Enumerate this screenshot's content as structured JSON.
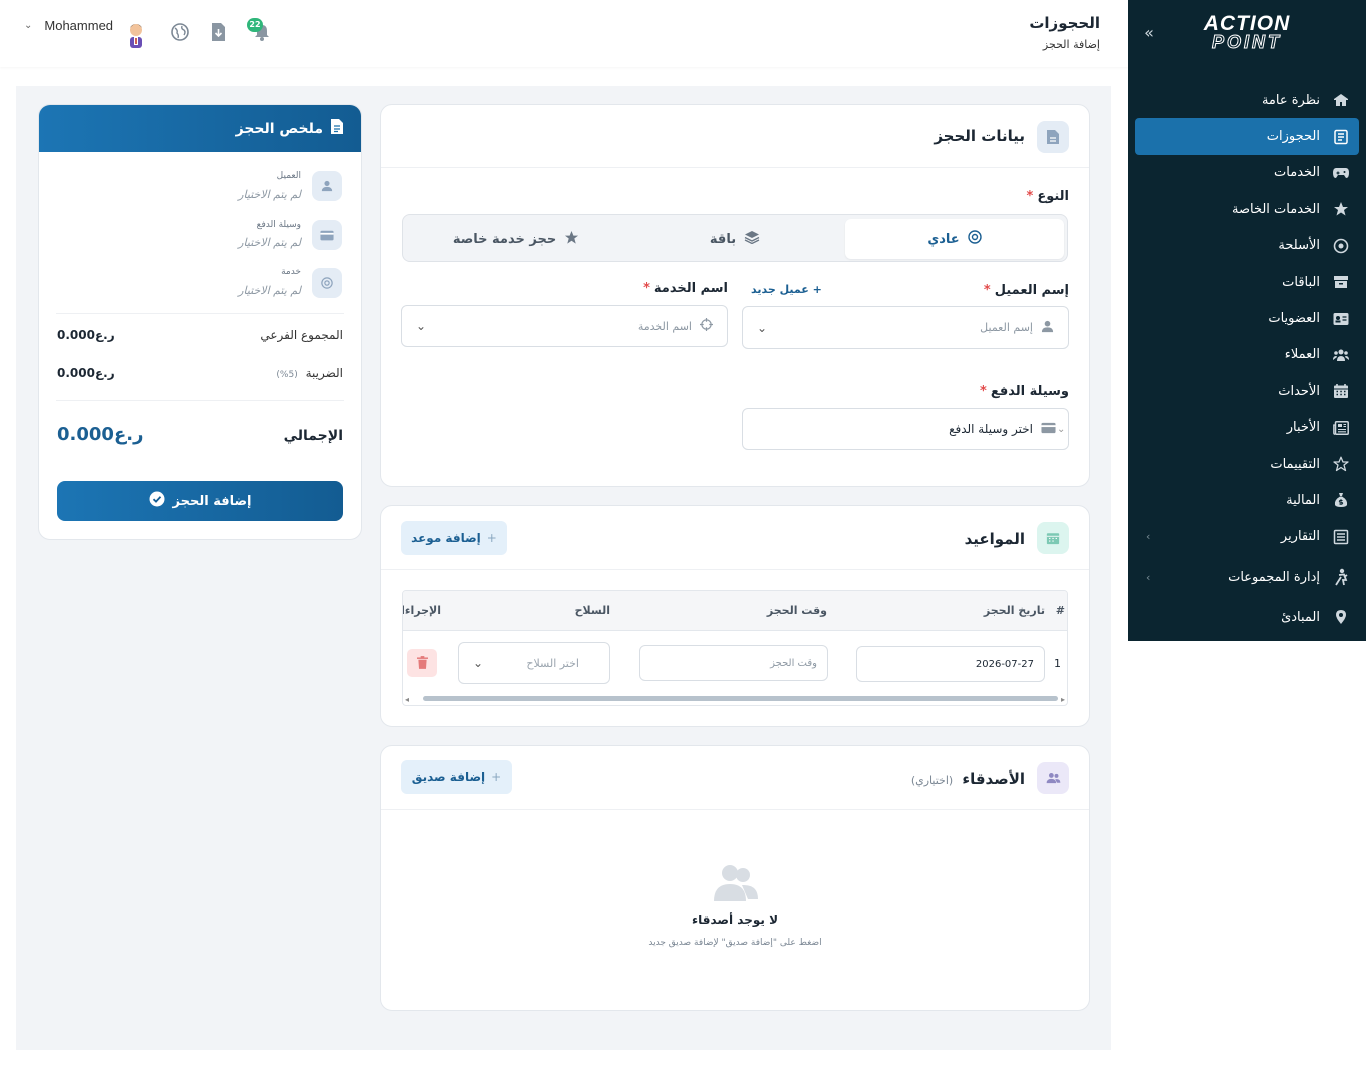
{
  "header": {
    "title": "الحجوزات",
    "subtitle": "إضافة الحجز",
    "user_name": "Mohammed",
    "notification_count": "22"
  },
  "sidebar": {
    "logo_line1": "ACTION",
    "logo_line2": "POINT",
    "items": [
      {
        "label": "نظرة عامة",
        "icon": "home-icon"
      },
      {
        "label": "الحجوزات",
        "icon": "bookings-icon",
        "active": true
      },
      {
        "label": "الخدمات",
        "icon": "gamepad-icon"
      },
      {
        "label": "الخدمات الخاصة",
        "icon": "star-icon"
      },
      {
        "label": "الأسلحة",
        "icon": "weapon-icon"
      },
      {
        "label": "الباقات",
        "icon": "package-icon"
      },
      {
        "label": "العضويات",
        "icon": "id-card-icon"
      },
      {
        "label": "العملاء",
        "icon": "users-icon"
      },
      {
        "label": "الأحداث",
        "icon": "calendar-icon"
      },
      {
        "label": "الأخبار",
        "icon": "news-icon"
      },
      {
        "label": "التقييمات",
        "icon": "star-outline-icon"
      },
      {
        "label": "المالية",
        "icon": "money-bag-icon"
      },
      {
        "label": "التقارير",
        "icon": "report-icon",
        "has_children": true
      },
      {
        "label": "إدارة المجموعات",
        "icon": "group-icon",
        "has_children": true
      },
      {
        "label": "المبادئ",
        "icon": "location-icon"
      }
    ]
  },
  "booking": {
    "title": "بيانات الحجز",
    "type_label": "النوع",
    "type_options": [
      "عادي",
      "باقة",
      "حجز خدمة خاصة"
    ],
    "customer_label": "إسم العميل",
    "new_customer": "عميل جديد",
    "customer_placeholder": "إسم العميل",
    "service_label": "اسم الخدمة",
    "service_placeholder": "اسم الخدمة",
    "payment_label": "وسيلة الدفع",
    "payment_value": "اختر وسيلة الدفع"
  },
  "appointments": {
    "title": "المواعيد",
    "add_button": "إضافة موعد",
    "columns": [
      "#",
      "تاريخ الحجز",
      "وقت الحجز",
      "السلاح",
      "الإجراءا"
    ],
    "rows": [
      {
        "index": "1",
        "date": "2026-07-27",
        "time_placeholder": "وقت الحجز",
        "weapon_placeholder": "اختر السلاح"
      }
    ]
  },
  "friends": {
    "title": "الأصدقاء",
    "optional": "(اختياري)",
    "add_button": "إضافة صديق",
    "empty_title": "لا يوجد أصدقاء",
    "empty_hint": "اضغط على \"إضافة صديق\" لإضافة صديق جديد"
  },
  "summary": {
    "title": "ملخص الحجز",
    "items": [
      {
        "label": "العميل",
        "value": "لم يتم الاختيار"
      },
      {
        "label": "وسيلة الدفع",
        "value": "لم يتم الاختيار"
      },
      {
        "label": "خدمة",
        "value": "لم يتم الاختيار"
      }
    ],
    "subtotal_label": "المجموع الفرعي",
    "subtotal_value": "0.000",
    "tax_label": "الضريبة",
    "tax_rate": "(5%)",
    "tax_value": "0.000",
    "currency": "ر.ع",
    "total_label": "الإجمالي",
    "total_value": "0.000",
    "submit_button": "إضافة الحجز"
  },
  "colors": {
    "sidebar": "#0b2530",
    "primary": "#1b71ab",
    "danger": "#e24b4b"
  }
}
